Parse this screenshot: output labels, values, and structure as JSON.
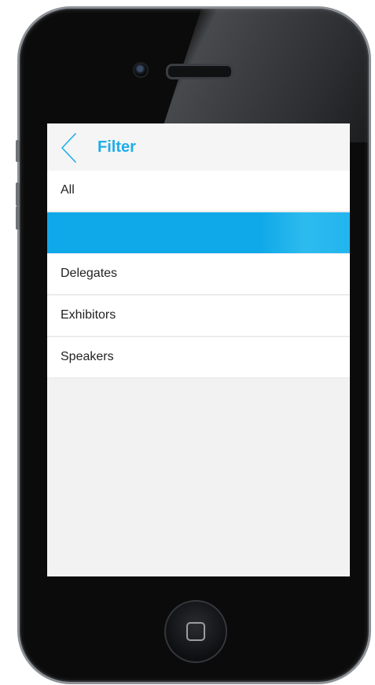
{
  "header": {
    "title": "Filter",
    "back_icon": "chevron-left-icon",
    "accent_color": "#1eaee8"
  },
  "filter_list": {
    "items": [
      {
        "label": "All",
        "selected": false
      },
      {
        "label": "",
        "selected": true
      },
      {
        "label": "Delegates",
        "selected": false
      },
      {
        "label": "Exhibitors",
        "selected": false
      },
      {
        "label": "Speakers",
        "selected": false
      }
    ],
    "selected_color": "#0fa8e8"
  },
  "device": {
    "home_icon": "home-button-icon"
  }
}
